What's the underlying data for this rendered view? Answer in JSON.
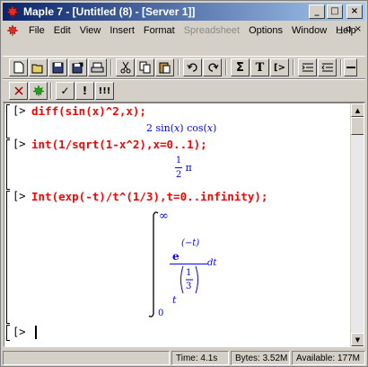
{
  "window": {
    "title": "Maple 7 - [Untitled (8) - [Server 1]]",
    "controls": {
      "minimize": "_",
      "maximize": "□",
      "close": "×"
    }
  },
  "menu": {
    "items": [
      {
        "label": "File",
        "disabled": false
      },
      {
        "label": "Edit",
        "disabled": false
      },
      {
        "label": "View",
        "disabled": false
      },
      {
        "label": "Insert",
        "disabled": false
      },
      {
        "label": "Format",
        "disabled": false
      },
      {
        "label": "Spreadsheet",
        "disabled": true
      },
      {
        "label": "Options",
        "disabled": false
      },
      {
        "label": "Window",
        "disabled": false
      },
      {
        "label": "Help",
        "disabled": false
      }
    ],
    "doc_controls": {
      "minimize": "_",
      "restore": "▫",
      "close": "×"
    }
  },
  "toolbar1": {
    "buttons": [
      "new-icon",
      "open-icon",
      "save-icon",
      "save-as-icon",
      "print-icon",
      "cut-icon",
      "copy-icon",
      "paste-icon",
      "undo-icon",
      "redo-icon",
      "sigma-icon",
      "text-icon",
      "input-icon",
      "indent-icon",
      "outdent-icon",
      "back-icon",
      "forward-icon",
      "more-icon"
    ],
    "labels": {
      "sigma": "Σ",
      "text": "T",
      "input": "[>"
    }
  },
  "toolbar2": {
    "buttons": [
      "interrupt-icon",
      "debug-icon",
      "execute-icon",
      "exclaim-icon",
      "execute-all-icon"
    ],
    "labels": {
      "execute": "✓",
      "exclaim": "!",
      "execute_all": "!!!"
    }
  },
  "worksheet": {
    "prompt": "[>",
    "groups": [
      {
        "input": "diff(sin(x)^2,x);",
        "output": {
          "coef": "2",
          "f1": "sin",
          "v1": "x",
          "f2": "cos",
          "v2": "x"
        }
      },
      {
        "input": "int(1/sqrt(1-x^2),x=0..1);",
        "output": {
          "num": "1",
          "den": "2",
          "sym": "π"
        }
      },
      {
        "input": "Int(exp(-t)/t^(1/3),t=0..infinity);",
        "output": {
          "upper": "∞",
          "lower": "0",
          "base": "e",
          "exp_neg_t": "(−t)",
          "t": "t",
          "exp_num": "1",
          "exp_den": "3",
          "dt": "dt"
        }
      }
    ]
  },
  "status": {
    "time": "Time:  4.1s",
    "bytes": "Bytes: 3.52M",
    "available": "Available: 177M"
  },
  "colors": {
    "input": "#ff0000",
    "output": "#0000ff",
    "titlebar_start": "#0a246a",
    "titlebar_end": "#a6caf0"
  }
}
